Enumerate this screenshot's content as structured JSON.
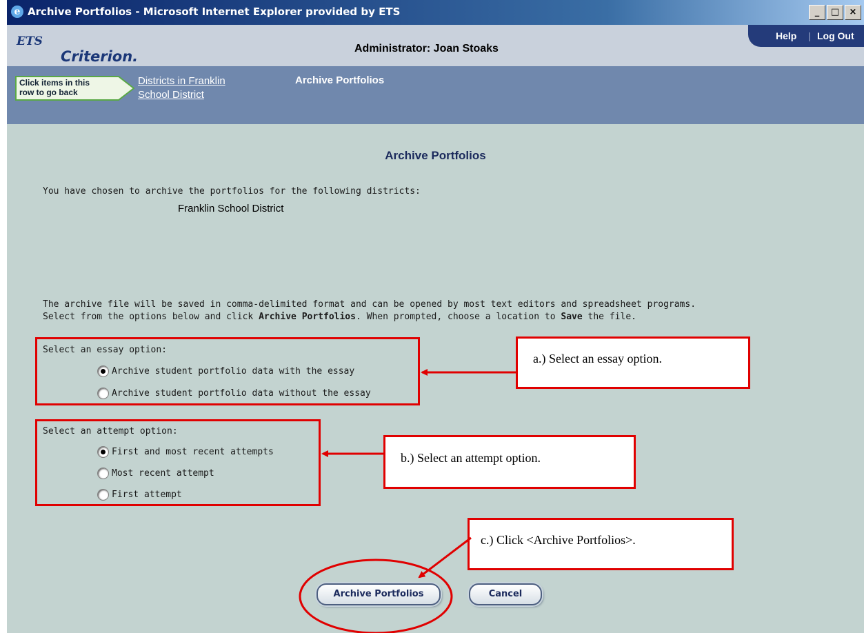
{
  "window": {
    "title": "Archive Portfolios - Microsoft Internet Explorer provided by ETS",
    "controls": [
      "_",
      "□",
      "×"
    ]
  },
  "header": {
    "logo_ets": "ETS",
    "logo_criterion": "Criterion.",
    "admin": "Administrator: Joan Stoaks",
    "help": "Help",
    "separator": "|",
    "logout": "Log Out"
  },
  "nav": {
    "back_badge": [
      "Click items in this",
      "row to go back"
    ],
    "crumb": [
      "Districts in Franklin",
      "School District"
    ],
    "current": "Archive Portfolios"
  },
  "main": {
    "title": "Archive Portfolios",
    "intro": "You have chosen to archive the portfolios for the following districts:",
    "district": "Franklin School District",
    "info_line1": "The archive file will be saved in comma-delimited format and can be opened by most text editors and spreadsheet programs.",
    "info_line2": {
      "part1": "Select from the options below and click ",
      "bold1": "Archive Portfolios",
      "part2": ". When prompted, choose a location to ",
      "bold2": "Save",
      "part3": " the file."
    }
  },
  "essay_options": {
    "label": "Select an essay option:",
    "options": [
      {
        "label": "Archive student portfolio data with the essay",
        "selected": true
      },
      {
        "label": "Archive student portfolio data without the essay",
        "selected": false
      }
    ]
  },
  "attempt_options": {
    "label": "Select an attempt option:",
    "options": [
      {
        "label": "First and most recent attempts",
        "selected": true
      },
      {
        "label": "Most recent attempt",
        "selected": false
      },
      {
        "label": "First attempt",
        "selected": false
      }
    ]
  },
  "buttons": {
    "archive": "Archive Portfolios",
    "cancel": "Cancel"
  },
  "callouts": {
    "a": "a.)  Select an essay option.",
    "b": "b.)  Select an attempt option.",
    "c": "c.)  Click <Archive Portfolios>."
  },
  "colors": {
    "annotation_red": "#e00000",
    "content_bg": "#c3d3d0",
    "nav_bg": "#7088ad",
    "header_bg": "#c9d1dc"
  }
}
